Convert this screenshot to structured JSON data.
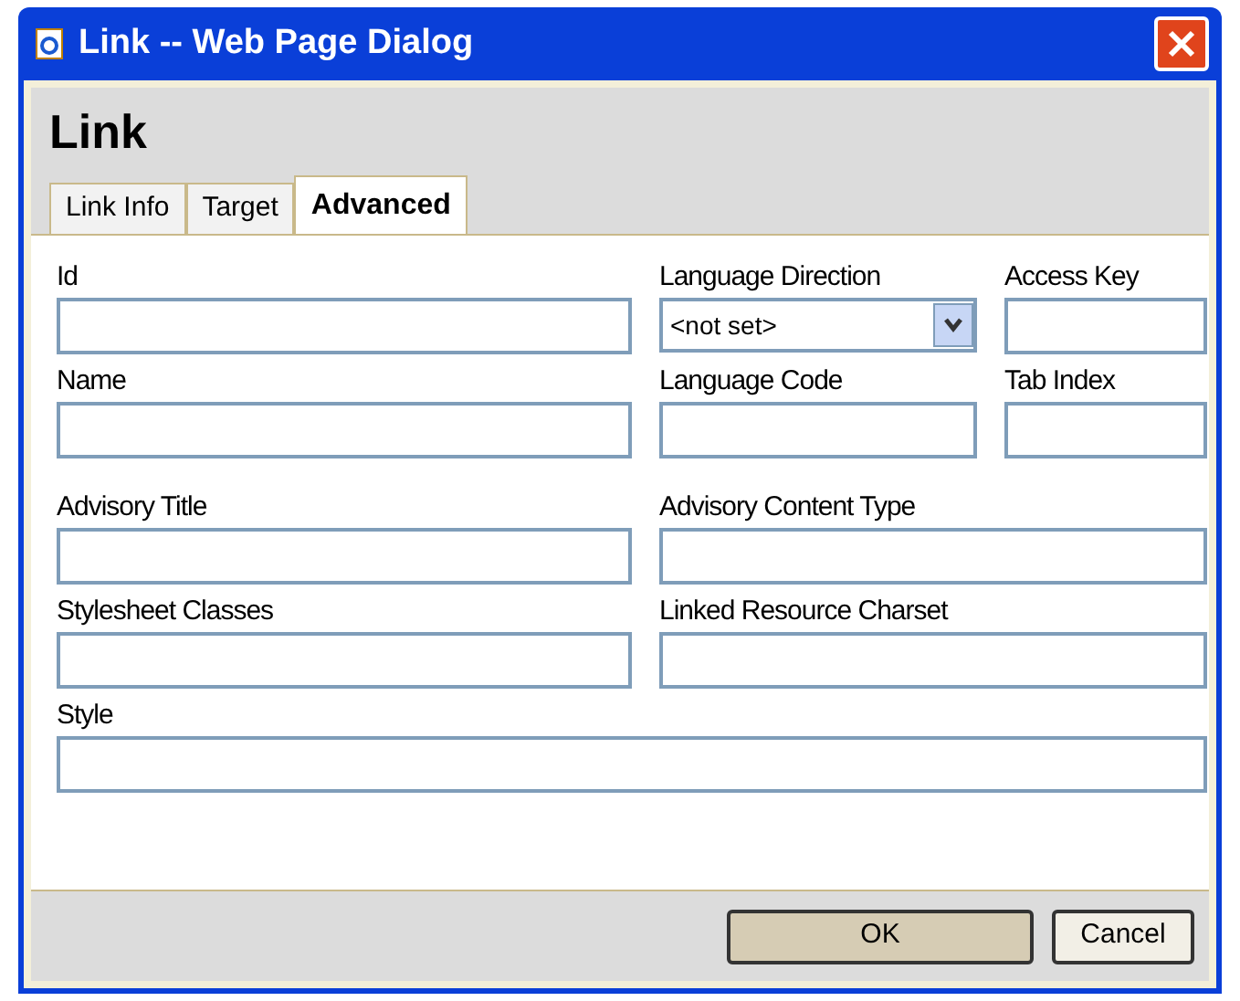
{
  "window": {
    "title": "Link -- Web Page Dialog"
  },
  "heading": "Link",
  "tabs": [
    {
      "label": "Link Info",
      "selected": false
    },
    {
      "label": "Target",
      "selected": false
    },
    {
      "label": "Advanced",
      "selected": true
    }
  ],
  "groups": [
    [
      [
        {
          "label": "Id",
          "kind": "text"
        },
        {
          "label": "Language Direction",
          "kind": "select",
          "value": "<not set>"
        },
        {
          "label": "Access Key",
          "kind": "text"
        }
      ],
      [
        {
          "label": "Name",
          "kind": "text"
        },
        {
          "label": "Language Code",
          "kind": "text"
        },
        {
          "label": "Tab Index",
          "kind": "text"
        }
      ]
    ],
    [
      [
        {
          "label": "Advisory Title",
          "kind": "text"
        },
        {
          "label": "Advisory Content Type",
          "kind": "text"
        }
      ],
      [
        {
          "label": "Stylesheet Classes",
          "kind": "text"
        },
        {
          "label": "Linked Resource Charset",
          "kind": "text"
        }
      ],
      [
        {
          "label": "Style",
          "kind": "text"
        }
      ]
    ]
  ],
  "buttons": [
    {
      "label": "OK",
      "kind": "default"
    },
    {
      "label": "Cancel",
      "kind": "normal"
    }
  ]
}
